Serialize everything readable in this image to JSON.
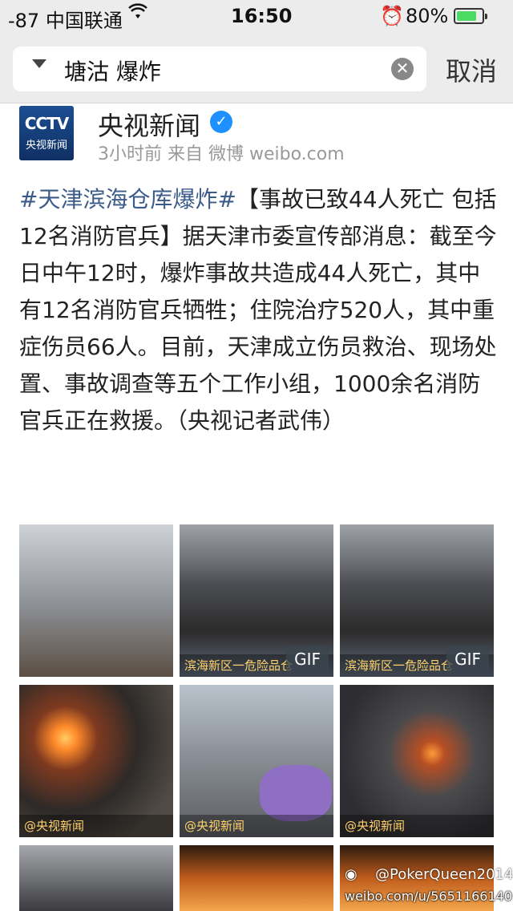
{
  "status_bar": {
    "signal": "-87 中国联通",
    "wifi_icon": "wifi-icon",
    "time": "16:50",
    "alarm_icon": "alarm-icon",
    "battery_percent": "80%",
    "battery_level": 0.8
  },
  "search": {
    "query": "塘沽 爆炸",
    "cancel_label": "取消"
  },
  "post": {
    "logo_text": "CCTV",
    "logo_sub": "央视新闻",
    "author": "央视新闻",
    "meta": "3小时前  来自 微博 weibo.com",
    "hashtag": "#天津滨海仓库爆炸#",
    "text": "【事故已致44人死亡 包括12名消防官兵】据天津市委宣传部消息：截至今日中午12时，爆炸事故共造成44人死亡，其中有12名消防官兵牺牲；住院治疗520人，其中重症伤员66人。目前，天津成立伤员救治、现场处置、事故调查等五个工作小组，1000余名消防官兵正在救援。（央视记者武伟）"
  },
  "images": [
    {
      "gif": "",
      "caption": ""
    },
    {
      "gif": "GIF",
      "caption": "滨海新区一危险品仓"
    },
    {
      "gif": "GIF",
      "caption": "滨海新区一危险品仓"
    },
    {
      "gif": "",
      "caption": "@央视新闻"
    },
    {
      "gif": "",
      "caption": "@央视新闻"
    },
    {
      "gif": "",
      "caption": "@央视新闻"
    },
    {
      "gif": "",
      "caption": ""
    },
    {
      "gif": "",
      "caption": ""
    },
    {
      "gif": "",
      "caption": ""
    }
  ],
  "watermark": {
    "user": "@PokerQueen2014",
    "url": "weibo.com/u/5651166140"
  }
}
